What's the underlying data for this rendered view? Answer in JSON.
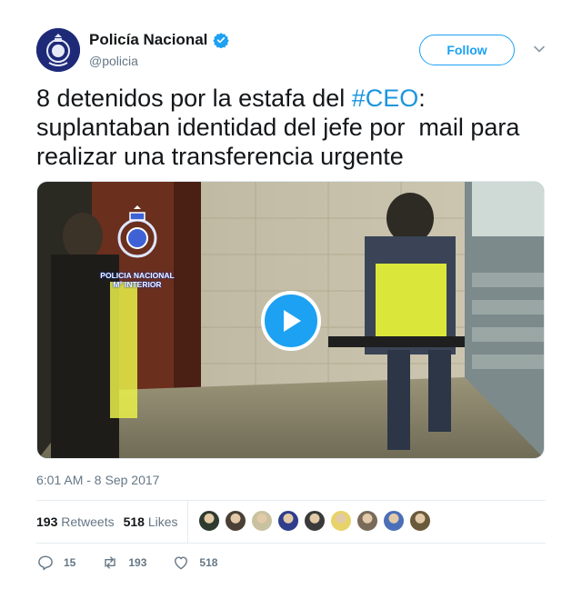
{
  "author": {
    "display_name": "Policía Nacional",
    "handle": "@policia",
    "verified": true,
    "follow_label": "Follow"
  },
  "tweet": {
    "text_before": "8 detenidos por la estafa del ",
    "hashtag": "#CEO",
    "text_after": ":\nsuplantaban identidad del jefe por  mail para\nrealizar una transferencia urgente",
    "timestamp": "6:01 AM - 8 Sep 2017"
  },
  "media": {
    "type": "video",
    "watermark_lines": [
      "POLICIA NACIONAL",
      "Mº INTERIOR"
    ]
  },
  "stats": {
    "retweets_count": "193",
    "retweets_label": "Retweets",
    "likes_count": "518",
    "likes_label": "Likes",
    "liker_avatars": [
      "#2f3b2f",
      "#4a4036",
      "#c9c2a0",
      "#2f3d8a",
      "#3a3a3a",
      "#e8d36a",
      "#7a6a5a",
      "#4b6fb8",
      "#6a5a3c"
    ]
  },
  "actions": {
    "replies": "15",
    "retweets": "193",
    "likes": "518"
  },
  "colors": {
    "accent": "#1da1f2",
    "hashtag": "#1b95e0",
    "secondary_text": "#657786"
  }
}
